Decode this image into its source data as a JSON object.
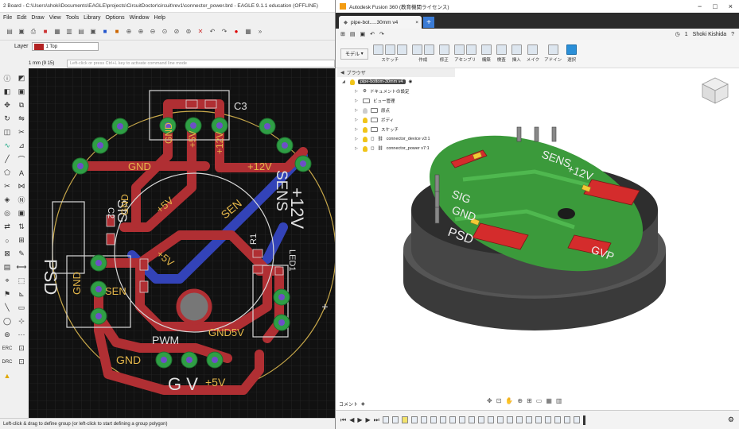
{
  "eagle": {
    "title": "2 Board - C:\\Users\\shoki\\Documents\\EAGLE\\projects\\CircuitDoctor\\circuit\\rev1\\connector_power.brd - EAGLE 9.1.1 education (OFFLINE)",
    "menu": [
      "File",
      "Edit",
      "Draw",
      "View",
      "Tools",
      "Library",
      "Options",
      "Window",
      "Help"
    ],
    "layer_label": "Layer",
    "layer_value": "1 Top",
    "coord": "1 mm (9 15)",
    "cmd_placeholder": "Left-click or press Ctrl+L key to activate command line mode",
    "status": "Left-click & drag to define group (or left-click to start defining a group polygon)",
    "board_labels": {
      "c3": "C3",
      "gnd_top_vert": "GND",
      "p5v_top_vert": "+5V",
      "p12v_top_vert": "+12V",
      "sens_vert": "SENS",
      "gnd_left": "GND",
      "p12v_right": "+12V",
      "sig_vert": "SIG",
      "gnd_vert_left": "GND",
      "c2": "C2",
      "p5v_mid": "+5V",
      "sen_diag": "SEN",
      "p12v_big": "+12V",
      "p5v_mid2": "+5V",
      "r1": "R1",
      "led1": "LED1",
      "psd": "PSD",
      "gnd_lower_vert": "GND",
      "sen_lower": "SEN",
      "gnd5v": "GND5V",
      "plus": "+",
      "pwm": "PWM",
      "gnd_bottom": "GND",
      "p5v_bottom": "+5V",
      "gv_bottom": "G V"
    },
    "colors": {
      "copper_top": "#b02f33",
      "copper_bottom": "#3343b8",
      "pad": "#2f9e45",
      "silk": "#d9d9d9",
      "canvas": "#111111"
    }
  },
  "fusion": {
    "title": "Autodesk Fusion 360 (教育機関ライセンス)",
    "tab_label": "pipe-bot.....30mm v4",
    "quick": {
      "user": "Shoki Kishida",
      "timer": "1"
    },
    "ribbon": {
      "workspace": "モデル",
      "groups": [
        "スケッチ",
        "作成",
        "修正",
        "アセンブリ",
        "構築",
        "検査",
        "挿入",
        "メイク",
        "アドイン",
        "選択"
      ]
    },
    "browser": {
      "title": "ブラウザ",
      "root": "pipe-bottom-30mm v4",
      "items": [
        {
          "label": "ドキュメントの設定",
          "kind": "gear"
        },
        {
          "label": "ビュー管理",
          "kind": "folder"
        },
        {
          "label": "原点",
          "kind": "folder"
        },
        {
          "label": "ボディ",
          "kind": "folder"
        },
        {
          "label": "スケッチ",
          "kind": "folder"
        },
        {
          "label": "connector_device v3:1",
          "kind": "link"
        },
        {
          "label": "connector_power v7:1",
          "kind": "link"
        }
      ]
    },
    "model_labels": {
      "sens": "SENS",
      "p12v": "+12V",
      "sig": "SIG",
      "gnd": "GND",
      "psd": "PSD",
      "gvp": "GVP"
    },
    "comment_label": "コメント",
    "colors": {
      "pcb": "#3b9a3b",
      "pad": "#d42c2c",
      "body": "#4a4a4a"
    }
  }
}
